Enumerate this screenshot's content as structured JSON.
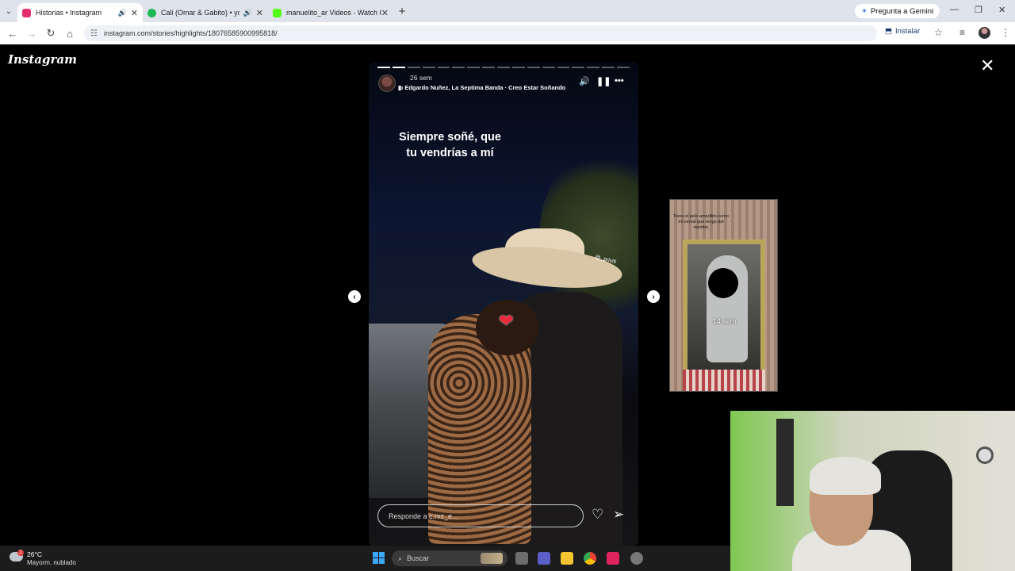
{
  "browser": {
    "tabs": [
      {
        "title": "Historias • Instagram",
        "active": true,
        "audio": true,
        "favicon_color": "#e1306c"
      },
      {
        "title": "Cali (Omar & Gabito) • you...",
        "active": false,
        "audio": true,
        "favicon_color": "#1db954"
      },
      {
        "title": "manuelito_ar Videos - Watch C...",
        "active": false,
        "audio": false,
        "favicon_color": "#53fc18"
      }
    ],
    "gemini_label": "Pregunta a Gemini",
    "url": "instagram.com/stories/highlights/18076585900995818/",
    "install_label": "Instalar"
  },
  "instagram": {
    "logo": "Instagram",
    "story": {
      "progress_total": 17,
      "progress_done": 2,
      "time_ago": "26 sem",
      "music": "Edgardo Nuñez, La Septima Banda · Creo Estar Soñando",
      "caption_line1": "Siempre soñé, que",
      "caption_line2": "tu vendrías a mí",
      "mention": "@_priviti"
    },
    "reply_placeholder": "Responde a c.rvz_e...",
    "next_story": {
      "time_ago": "14 sem",
      "note": "Tiene el pelo amarillito como mi cereal que tengo del membe"
    }
  },
  "taskbar": {
    "weather_badge": "2",
    "temperature": "26°C",
    "condition": "Mayorm. nublado",
    "search_placeholder": "Buscar"
  },
  "colors": {
    "chrome_bg": "#dfe3eb",
    "accent_start": "#3ba7f5"
  }
}
